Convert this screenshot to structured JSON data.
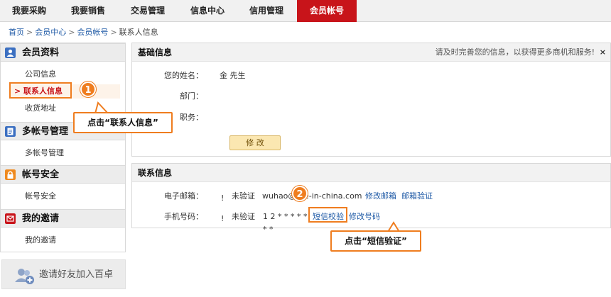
{
  "topnav": {
    "tabs": [
      {
        "label": "我要采购"
      },
      {
        "label": "我要销售"
      },
      {
        "label": "交易管理"
      },
      {
        "label": "信息中心"
      },
      {
        "label": "信用管理"
      },
      {
        "label": "会员帐号",
        "active": true
      }
    ],
    "active_color": "#c8141a"
  },
  "breadcrumb": {
    "items": [
      "首页",
      "会员中心",
      "会员帐号"
    ],
    "current": "联系人信息",
    "separator": ">"
  },
  "sidebar": {
    "sections": [
      {
        "title": "会员资料",
        "icon": "profile-icon",
        "items": [
          "公司信息",
          "联系人信息",
          "收货地址"
        ]
      },
      {
        "title": "多帐号管理",
        "icon": "document-icon",
        "items": [
          "多帐号管理"
        ]
      },
      {
        "title": "帐号安全",
        "icon": "lock-icon",
        "items": [
          "帐号安全"
        ]
      },
      {
        "title": "我的邀请",
        "icon": "invite-icon",
        "items": [
          "我的邀请"
        ]
      }
    ],
    "active_item": "联系人信息",
    "invite_banner": "邀请好友加入百卓"
  },
  "basic_info": {
    "title": "基础信息",
    "note": "请及时完善您的信息，以获得更多商机和服务!",
    "close": "×",
    "fields": [
      {
        "label": "您的姓名：",
        "value": "金 先生"
      },
      {
        "label": "部门：",
        "value": ""
      },
      {
        "label": "职务：",
        "value": ""
      }
    ],
    "edit_button": "修 改"
  },
  "contact_info": {
    "title": "联系信息",
    "email": {
      "label": "电子邮箱：",
      "status": "未验证",
      "value_left": "wuhao@",
      "value_right": "e-in-china.com",
      "links": [
        "修改邮箱",
        "邮箱验证"
      ]
    },
    "phone": {
      "label": "手机号码：",
      "status": "未验证",
      "value": "1 2 * * * * * * *",
      "links": [
        "短信校验",
        "修改号码"
      ]
    }
  },
  "callouts": [
    {
      "number": "1",
      "text": "点击“联系人信息”"
    },
    {
      "number": "2",
      "text": "点击“短信验证”"
    }
  ],
  "colors": {
    "accent": "#ef7d1f",
    "link": "#1f5aa6",
    "warning_dot": "#f2b300"
  }
}
